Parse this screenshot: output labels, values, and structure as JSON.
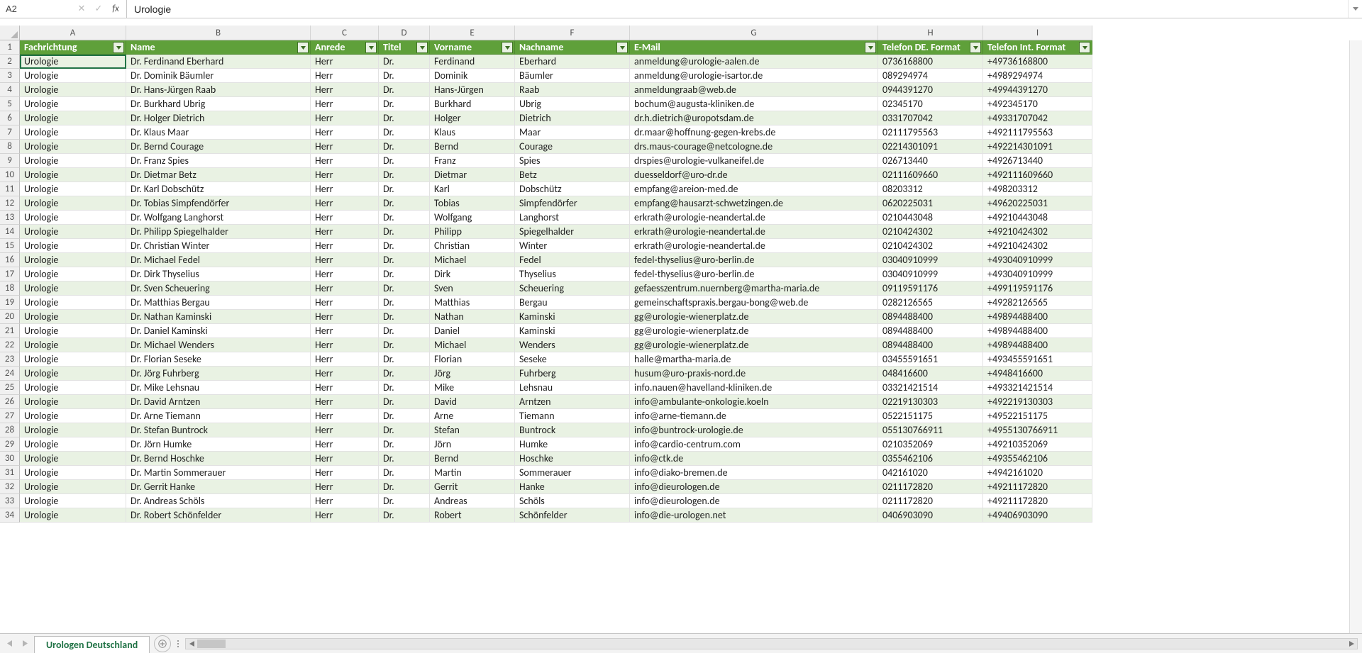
{
  "formula_bar": {
    "name_box": "A2",
    "cancel": "✕",
    "enter": "✓",
    "fx": "fx",
    "value": "Urologie"
  },
  "columns": [
    {
      "letter": "A",
      "cls": "cA"
    },
    {
      "letter": "B",
      "cls": "cB"
    },
    {
      "letter": "C",
      "cls": "cC"
    },
    {
      "letter": "D",
      "cls": "cD"
    },
    {
      "letter": "E",
      "cls": "cE"
    },
    {
      "letter": "F",
      "cls": "cF"
    },
    {
      "letter": "G",
      "cls": "cG"
    },
    {
      "letter": "H",
      "cls": "cH"
    },
    {
      "letter": "I",
      "cls": "cI"
    }
  ],
  "headers": [
    "Fachrichtung",
    "Name",
    "Anrede",
    "Titel",
    "Vorname",
    "Nachname",
    "E-Mail",
    "Telefon DE. Format",
    "Telefon Int. Format"
  ],
  "rows": [
    [
      "Urologie",
      "Dr. Ferdinand Eberhard",
      "Herr",
      "Dr.",
      "Ferdinand",
      "Eberhard",
      "anmeldung@urologie-aalen.de",
      "0736168800",
      "+49736168800"
    ],
    [
      "Urologie",
      "Dr. Dominik Bäumler",
      "Herr",
      "Dr.",
      "Dominik",
      "Bäumler",
      "anmeldung@urologie-isartor.de",
      "089294974",
      "+4989294974"
    ],
    [
      "Urologie",
      "Dr. Hans-Jürgen Raab",
      "Herr",
      "Dr.",
      "Hans-Jürgen",
      "Raab",
      "anmeldungraab@web.de",
      "0944391270",
      "+49944391270"
    ],
    [
      "Urologie",
      "Dr. Burkhard Ubrig",
      "Herr",
      "Dr.",
      "Burkhard",
      "Ubrig",
      "bochum@augusta-kliniken.de",
      "02345170",
      "+492345170"
    ],
    [
      "Urologie",
      "Dr. Holger Dietrich",
      "Herr",
      "Dr.",
      "Holger",
      "Dietrich",
      "dr.h.dietrich@uropotsdam.de",
      "0331707042",
      "+49331707042"
    ],
    [
      "Urologie",
      "Dr. Klaus Maar",
      "Herr",
      "Dr.",
      "Klaus",
      "Maar",
      "dr.maar@hoffnung-gegen-krebs.de",
      "02111795563",
      "+492111795563"
    ],
    [
      "Urologie",
      "Dr. Bernd Courage",
      "Herr",
      "Dr.",
      "Bernd",
      "Courage",
      "drs.maus-courage@netcologne.de",
      "02214301091",
      "+492214301091"
    ],
    [
      "Urologie",
      "Dr. Franz Spies",
      "Herr",
      "Dr.",
      "Franz",
      "Spies",
      "drspies@urologie-vulkaneifel.de",
      "026713440",
      "+4926713440"
    ],
    [
      "Urologie",
      "Dr. Dietmar Betz",
      "Herr",
      "Dr.",
      "Dietmar",
      "Betz",
      "duesseldorf@uro-dr.de",
      "02111609660",
      "+492111609660"
    ],
    [
      "Urologie",
      "Dr. Karl Dobschütz",
      "Herr",
      "Dr.",
      "Karl",
      "Dobschütz",
      "empfang@areion-med.de",
      "08203312",
      "+498203312"
    ],
    [
      "Urologie",
      "Dr. Tobias Simpfendörfer",
      "Herr",
      "Dr.",
      "Tobias",
      "Simpfendörfer",
      "empfang@hausarzt-schwetzingen.de",
      "0620225031",
      "+49620225031"
    ],
    [
      "Urologie",
      "Dr. Wolfgang Langhorst",
      "Herr",
      "Dr.",
      "Wolfgang",
      "Langhorst",
      "erkrath@urologie-neandertal.de",
      "0210443048",
      "+49210443048"
    ],
    [
      "Urologie",
      "Dr. Philipp Spiegelhalder",
      "Herr",
      "Dr.",
      "Philipp",
      "Spiegelhalder",
      "erkrath@urologie-neandertal.de",
      "0210424302",
      "+49210424302"
    ],
    [
      "Urologie",
      "Dr. Christian Winter",
      "Herr",
      "Dr.",
      "Christian",
      "Winter",
      "erkrath@urologie-neandertal.de",
      "0210424302",
      "+49210424302"
    ],
    [
      "Urologie",
      "Dr. Michael Fedel",
      "Herr",
      "Dr.",
      "Michael",
      "Fedel",
      "fedel-thyselius@uro-berlin.de",
      "03040910999",
      "+493040910999"
    ],
    [
      "Urologie",
      "Dr. Dirk Thyselius",
      "Herr",
      "Dr.",
      "Dirk",
      "Thyselius",
      "fedel-thyselius@uro-berlin.de",
      "03040910999",
      "+493040910999"
    ],
    [
      "Urologie",
      "Dr. Sven Scheuering",
      "Herr",
      "Dr.",
      "Sven",
      "Scheuering",
      "gefaesszentrum.nuernberg@martha-maria.de",
      "09119591176",
      "+499119591176"
    ],
    [
      "Urologie",
      "Dr. Matthias Bergau",
      "Herr",
      "Dr.",
      "Matthias",
      "Bergau",
      "gemeinschaftspraxis.bergau-bong@web.de",
      "0282126565",
      "+49282126565"
    ],
    [
      "Urologie",
      "Dr. Nathan Kaminski",
      "Herr",
      "Dr.",
      "Nathan",
      "Kaminski",
      "gg@urologie-wienerplatz.de",
      "0894488400",
      "+49894488400"
    ],
    [
      "Urologie",
      "Dr. Daniel Kaminski",
      "Herr",
      "Dr.",
      "Daniel",
      "Kaminski",
      "gg@urologie-wienerplatz.de",
      "0894488400",
      "+49894488400"
    ],
    [
      "Urologie",
      "Dr. Michael Wenders",
      "Herr",
      "Dr.",
      "Michael",
      "Wenders",
      "gg@urologie-wienerplatz.de",
      "0894488400",
      "+49894488400"
    ],
    [
      "Urologie",
      "Dr. Florian Seseke",
      "Herr",
      "Dr.",
      "Florian",
      "Seseke",
      "halle@martha-maria.de",
      "03455591651",
      "+493455591651"
    ],
    [
      "Urologie",
      "Dr. Jörg Fuhrberg",
      "Herr",
      "Dr.",
      "Jörg",
      "Fuhrberg",
      "husum@uro-praxis-nord.de",
      "048416600",
      "+4948416600"
    ],
    [
      "Urologie",
      "Dr. Mike Lehsnau",
      "Herr",
      "Dr.",
      "Mike",
      "Lehsnau",
      "info.nauen@havelland-kliniken.de",
      "03321421514",
      "+493321421514"
    ],
    [
      "Urologie",
      "Dr. David Arntzen",
      "Herr",
      "Dr.",
      "David",
      "Arntzen",
      "info@ambulante-onkologie.koeln",
      "02219130303",
      "+492219130303"
    ],
    [
      "Urologie",
      "Dr. Arne Tiemann",
      "Herr",
      "Dr.",
      "Arne",
      "Tiemann",
      "info@arne-tiemann.de",
      "0522151175",
      "+49522151175"
    ],
    [
      "Urologie",
      "Dr. Stefan Buntrock",
      "Herr",
      "Dr.",
      "Stefan",
      "Buntrock",
      "info@buntrock-urologie.de",
      "055130766911",
      "+4955130766911"
    ],
    [
      "Urologie",
      "Dr. Jörn Humke",
      "Herr",
      "Dr.",
      "Jörn",
      "Humke",
      "info@cardio-centrum.com",
      "0210352069",
      "+49210352069"
    ],
    [
      "Urologie",
      "Dr. Bernd Hoschke",
      "Herr",
      "Dr.",
      "Bernd",
      "Hoschke",
      "info@ctk.de",
      "0355462106",
      "+49355462106"
    ],
    [
      "Urologie",
      "Dr. Martin Sommerauer",
      "Herr",
      "Dr.",
      "Martin",
      "Sommerauer",
      "info@diako-bremen.de",
      "042161020",
      "+4942161020"
    ],
    [
      "Urologie",
      "Dr. Gerrit Hanke",
      "Herr",
      "Dr.",
      "Gerrit",
      "Hanke",
      "info@dieurologen.de",
      "0211172820",
      "+49211172820"
    ],
    [
      "Urologie",
      "Dr. Andreas Schöls",
      "Herr",
      "Dr.",
      "Andreas",
      "Schöls",
      "info@dieurologen.de",
      "0211172820",
      "+49211172820"
    ],
    [
      "Urologie",
      "Dr. Robert Schönfelder",
      "Herr",
      "Dr.",
      "Robert",
      "Schönfelder",
      "info@die-urologen.net",
      "0406903090",
      "+49406903090"
    ]
  ],
  "sheet": {
    "name": "Urologen Deutschland",
    "add_label": "+"
  },
  "colors": {
    "accent": "#217346",
    "header_bg": "#5fa03a",
    "band": "#e9f2e3"
  }
}
